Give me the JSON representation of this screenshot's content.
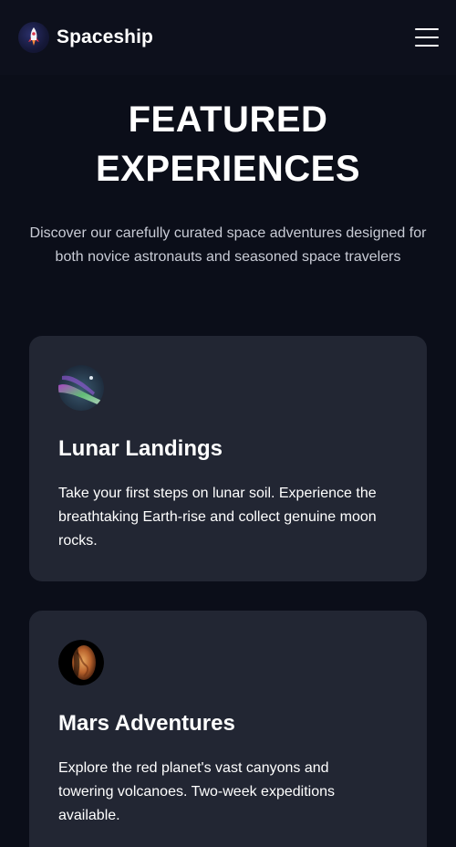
{
  "header": {
    "brand_name": "Spaceship",
    "logo_icon": "rocket-icon",
    "menu_icon": "hamburger-menu-icon"
  },
  "hero": {
    "title_line1": "FEATURED",
    "title_line2": "EXPERIENCES",
    "subtitle": "Discover our carefully curated space adventures designed for both novice astronauts and seasoned space travelers"
  },
  "cards": [
    {
      "icon": "aurora-earth-icon",
      "title": "Lunar Landings",
      "description": "Take your first steps on lunar soil. Experience the breathtaking Earth-rise and collect genuine moon rocks."
    },
    {
      "icon": "mars-planet-icon",
      "title": "Mars Adventures",
      "description": "Explore the red planet's vast canyons and towering volcanoes. Two-week expeditions available."
    }
  ],
  "colors": {
    "background": "#0b0e19",
    "card": "#222633",
    "text": "#ffffff",
    "muted_text": "#c9ccd6"
  }
}
